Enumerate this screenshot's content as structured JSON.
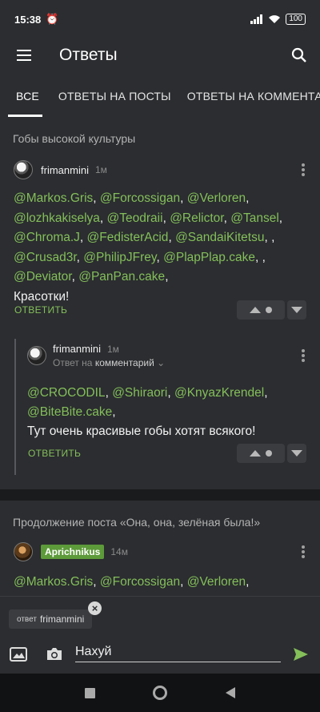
{
  "status_bar": {
    "time": "15:38",
    "battery": "100"
  },
  "app_bar": {
    "title": "Ответы"
  },
  "tabs": [
    "ВСЕ",
    "ОТВЕТЫ НА ПОСТЫ",
    "ОТВЕТЫ НА КОММЕНТАР"
  ],
  "post1": {
    "title": "Гобы высокой культуры",
    "comment": {
      "author": "frimanmini",
      "time": "1м",
      "mentions_line1": [
        "@Markos.Gris",
        "@Forcossigan",
        "@Verloren"
      ],
      "mentions_line2": [
        "@lozhkakiselya",
        "@Teodraii",
        "@Relictor",
        "@Tansel"
      ],
      "mentions_line3": [
        "@Chroma.J",
        "@FedisterAcid",
        "@SandaiKitetsu"
      ],
      "mentions_line4": [
        "@Crusad3r",
        "@PhilipJFrey",
        "@PlapPlap.cake"
      ],
      "mentions_line5": [
        "@Deviator",
        "@PanPan.cake"
      ],
      "text": "Красотки!",
      "reply_label": "ОТВЕТИТЬ"
    },
    "reply": {
      "author": "frimanmini",
      "time": "1м",
      "reply_to_prefix": "Ответ на",
      "reply_to_target": "комментарий",
      "mentions_line1": [
        "@CROCODIL",
        "@Shiraori",
        "@KnyazKrendel"
      ],
      "mentions_line2": [
        "@BiteBite.cake"
      ],
      "text": "Тут очень красивые гобы хотят всякого!",
      "reply_label": "ОТВЕТИТЬ"
    }
  },
  "post2": {
    "title": "Продолжение поста «Она, она, зелёная была!»",
    "comment": {
      "author": "Aprichnikus",
      "time": "14м",
      "mentions_line1": [
        "@Markos.Gris",
        "@Forcossigan",
        "@Verloren"
      ]
    }
  },
  "composer": {
    "reply_chip_prefix": "ответ",
    "reply_chip_user": "frimanmini",
    "input_value": "Нахуй"
  },
  "colors": {
    "accent": "#84bf5a",
    "background": "#2b2d30"
  }
}
